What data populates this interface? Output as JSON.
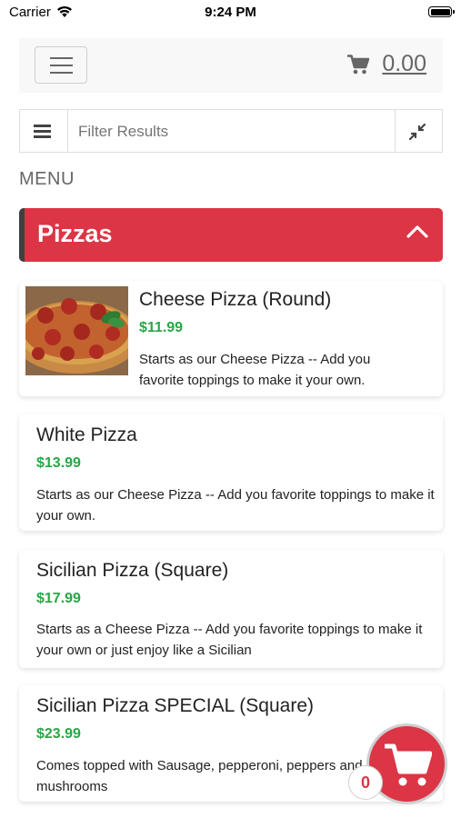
{
  "status_bar": {
    "carrier": "Carrier",
    "time": "9:24 PM"
  },
  "header": {
    "cart_total": "0.00"
  },
  "filter": {
    "placeholder": "Filter Results"
  },
  "menu_label": "MENU",
  "category": {
    "title": "Pizzas"
  },
  "items": [
    {
      "name": "Cheese Pizza (Round)",
      "price": "$11.99",
      "description": "Starts as our Cheese Pizza -- Add you favorite toppings to make it your own."
    },
    {
      "name": "White Pizza",
      "price": "$13.99",
      "description": "Starts as our Cheese Pizza -- Add you favorite toppings to make it your own."
    },
    {
      "name": "Sicilian Pizza (Square)",
      "price": "$17.99",
      "description": "Starts as a Cheese Pizza -- Add you favorite toppings to make it your own or just enjoy like a Sicilian"
    },
    {
      "name": "Sicilian Pizza SPECIAL (Square)",
      "price": "$23.99",
      "description": "Comes topped with Sausage, pepperoni, peppers and mushrooms"
    }
  ],
  "cart_fab": {
    "count": "0"
  },
  "icons": {
    "menu": "hamburger-icon",
    "cart": "cart-icon",
    "filter_menu": "list-icon",
    "collapse": "compress-icon",
    "chevron": "chevron-up-icon",
    "wifi": "wifi-icon",
    "battery": "battery-icon"
  },
  "colors": {
    "accent": "#dc3545",
    "price": "#28a745",
    "header_bg": "#f8f8f8"
  }
}
